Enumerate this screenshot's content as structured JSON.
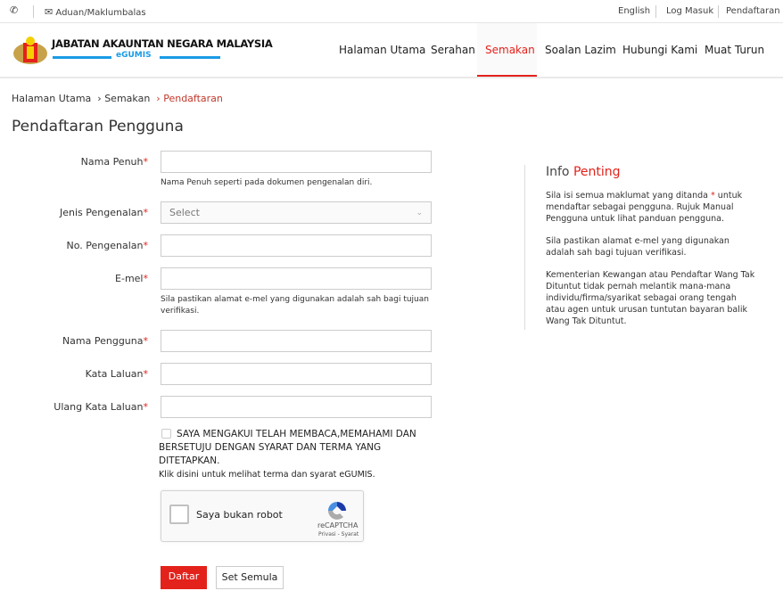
{
  "topbar": {
    "feedback": "Aduan/Maklumbalas",
    "links": [
      "English",
      "Log Masuk",
      "Pendaftaran"
    ]
  },
  "header": {
    "logo_title": "JABATAN AKAUNTAN NEGARA MALAYSIA",
    "logo_sub": "eGUMIS",
    "nav": [
      "Halaman Utama",
      "Serahan",
      "Semakan",
      "Soalan Lazim",
      "Hubungi Kami",
      "Muat Turun"
    ],
    "active_nav": "Semakan"
  },
  "breadcrumb": [
    "Halaman Utama",
    "Semakan",
    "Pendaftaran"
  ],
  "page_title": "Pendaftaran Pengguna",
  "form": {
    "full_name": {
      "label": "Nama Penuh",
      "value": "",
      "help": "Nama Penuh seperti pada dokumen pengenalan diri."
    },
    "id_type": {
      "label": "Jenis Pengenalan",
      "value": "Select"
    },
    "id_no": {
      "label": "No. Pengenalan",
      "value": ""
    },
    "email": {
      "label": "E-mel",
      "value": "",
      "help": "Sila pastikan alamat e-mel yang digunakan adalah sah bagi tujuan verifikasi."
    },
    "username": {
      "label": "Nama Pengguna",
      "value": ""
    },
    "password": {
      "label": "Kata Laluan",
      "value": ""
    },
    "password2": {
      "label": "Ulang Kata Laluan",
      "value": ""
    },
    "required_mark": "*",
    "agree": "SAYA MENGAKUI TELAH MEMBACA,MEMAHAMI DAN BERSETUJU DENGAN SYARAT DAN TERMA YANG DITETAPKAN.",
    "agree_checked": false,
    "terms_link": "Klik disini untuk melihat terma dan syarat eGUMIS.",
    "captcha": {
      "label": "Saya bukan robot",
      "brand": "reCAPTCHA",
      "links": "Privasi - Syarat"
    },
    "submit": "Daftar",
    "reset": "Set Semula"
  },
  "info": {
    "title_a": "Info",
    "title_b": "Penting",
    "p1a": "Sila isi semua maklumat yang ditanda",
    "p1b": "untuk mendaftar sebagai pengguna. Rujuk Manual Pengguna untuk lihat panduan pengguna.",
    "p2": "Sila pastikan alamat e-mel yang digunakan adalah sah bagi tujuan verifikasi.",
    "p3": "Kementerian Kewangan atau Pendaftar Wang Tak Dituntut tidak pernah melantik mana-mana individu/firma/syarikat sebagai orang tengah atau agen untuk urusan tuntutan bayaran balik Wang Tak Dituntut."
  },
  "colors": {
    "accent": "#e3221b",
    "logo_blue": "#1a9be6"
  }
}
